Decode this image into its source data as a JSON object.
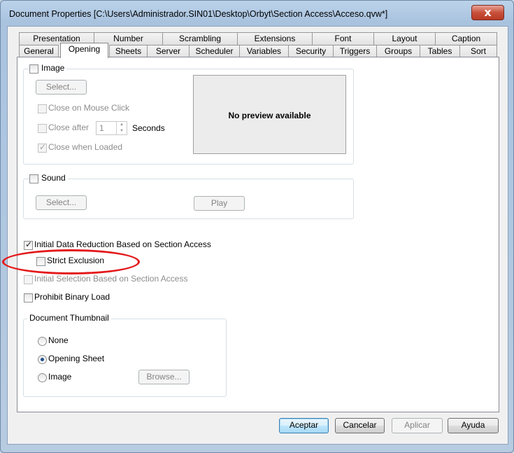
{
  "window": {
    "title": "Document Properties [C:\\Users\\Administrador.SIN01\\Desktop\\Orbyt\\Section Access\\Acceso.qvw*]",
    "close_label": "x"
  },
  "tabs": {
    "row1": [
      "Presentation",
      "Number",
      "Scrambling",
      "Extensions",
      "Font",
      "Layout",
      "Caption"
    ],
    "row2": [
      "General",
      "Opening",
      "Sheets",
      "Server",
      "Scheduler",
      "Variables",
      "Security",
      "Triggers",
      "Groups",
      "Tables",
      "Sort"
    ],
    "active": "Opening"
  },
  "image_group": {
    "label": "Image",
    "select_label": "Select...",
    "close_on_click": "Close on Mouse Click",
    "close_after": "Close after",
    "close_after_value": "1",
    "seconds": "Seconds",
    "close_when_loaded": "Close when Loaded",
    "preview_text": "No preview available"
  },
  "sound_group": {
    "label": "Sound",
    "select_label": "Select...",
    "play_label": "Play"
  },
  "options": {
    "initial_reduction": "Initial Data Reduction Based on Section Access",
    "strict_exclusion": "Strict Exclusion",
    "initial_selection": "Initial Selection Based on Section Access",
    "prohibit_binary": "Prohibit Binary Load"
  },
  "thumbnail": {
    "label": "Document Thumbnail",
    "none": "None",
    "opening_sheet": "Opening Sheet",
    "image": "Image",
    "browse_label": "Browse..."
  },
  "footer": {
    "ok": "Aceptar",
    "cancel": "Cancelar",
    "apply": "Aplicar",
    "help": "Ayuda"
  },
  "colors": {
    "annotation": "#e3191b",
    "accent": "#3c7fb1"
  }
}
